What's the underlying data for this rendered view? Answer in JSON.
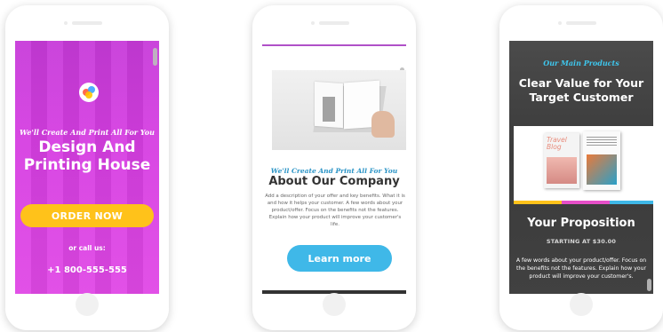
{
  "phone1": {
    "tagline": "We'll Create And Print All For You",
    "headline_line1": "Design And",
    "headline_line2": "Printing House",
    "button": "ORDER NOW",
    "call_label": "or call us:",
    "phone_number": "+1 800-555-555",
    "colors": {
      "background": "#d63ee2",
      "button": "#ffc21a"
    }
  },
  "phone2": {
    "tagline": "We'll Create And Print All For You",
    "title": "About Our Company",
    "body": "Add a description of your offer and key benefits. What it is and how it helps your customer. A few words about your product/offer. Focus on the benefits not the features. Explain how your product will improve your customer's life.",
    "button": "Learn more",
    "colors": {
      "accent": "#3fb8e8",
      "tagline": "#2b94c6"
    }
  },
  "phone3": {
    "eyebrow": "Our Main Products",
    "title_line1": "Clear Value for Your",
    "title_line2": "Target Customer",
    "book1_title": "Travel Blog",
    "proposition": "Your Proposition",
    "price": "STARTING AT $30.00",
    "description": "A few words about your product/offer. Focus on the benefits not the features. Explain how your product will improve your customer's.",
    "colors": {
      "eyebrow": "#3ec7ee",
      "stripe_yellow": "#ffc21a",
      "stripe_pink": "#e64fc8",
      "stripe_blue": "#3fb8e8"
    }
  }
}
